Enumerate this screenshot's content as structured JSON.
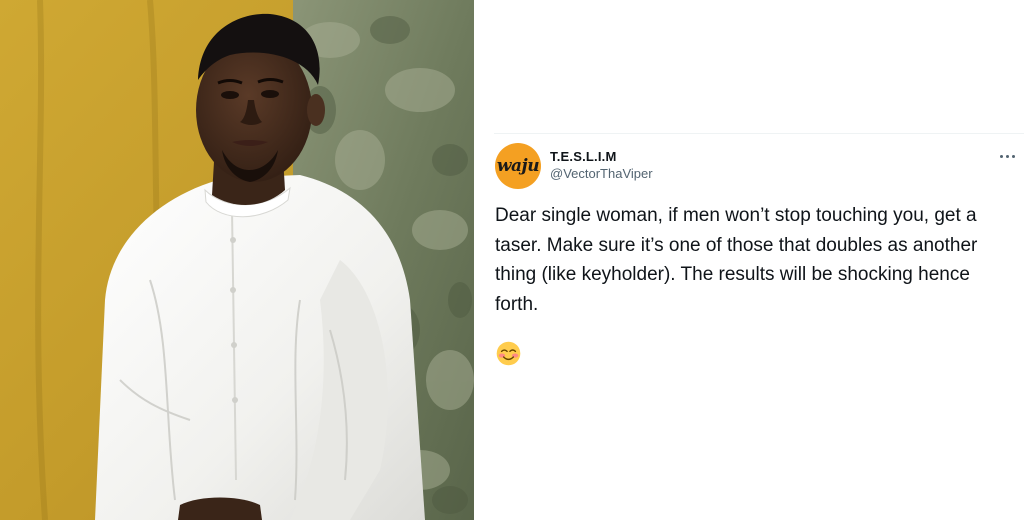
{
  "photo": {
    "subject": "photo-of-man"
  },
  "tweet": {
    "avatar_text": "waju",
    "display_name": "T.E.S.L.I.M",
    "handle": "@VectorThaViper",
    "body": "Dear single woman, if men won’t stop touching you, get a taser. Make sure it’s one of those that doubles as another thing (like keyholder). The results will be shocking hence forth.",
    "emoji": "smiling-face-with-blush-icon",
    "more_icon": "more-options-icon"
  },
  "colors": {
    "backdrop_yellow": "#c9a632",
    "backdrop_green": "#7d8a6c",
    "shirt_white": "#f4f4f2",
    "avatar_orange": "#f4a022",
    "text_primary": "#0f1419",
    "text_secondary": "#536471"
  }
}
